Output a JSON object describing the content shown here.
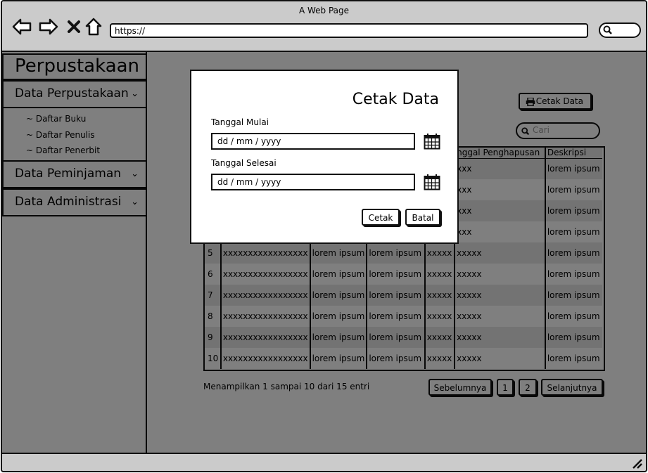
{
  "window": {
    "title": "A Web Page",
    "url": "https://"
  },
  "sidebar": {
    "title": "Perpustakaan",
    "groups": [
      {
        "label": "Data Perpustakaan",
        "items": [
          "~ Daftar Buku",
          "~ Daftar Penulis",
          "~ Daftar Penerbit"
        ]
      },
      {
        "label": "Data Peminjaman"
      },
      {
        "label": "Data Administrasi"
      }
    ]
  },
  "main": {
    "print_button": "Cetak Data",
    "search_placeholder": "Cari",
    "table": {
      "headers": [
        "nggal Penghapusan",
        "Deskripsi"
      ],
      "rows": [
        [
          "",
          "",
          "",
          "",
          "",
          "xxx",
          "lorem ipsum"
        ],
        [
          "",
          "",
          "",
          "",
          "",
          "xxx",
          "lorem ipsum"
        ],
        [
          "",
          "",
          "",
          "",
          "",
          "xxx",
          "lorem ipsum"
        ],
        [
          "",
          "",
          "",
          "",
          "",
          "xxx",
          "lorem ipsum"
        ],
        [
          "5",
          "xxxxxxxxxxxxxxxxx",
          "lorem ipsum",
          "lorem ipsum",
          "xxxxx",
          "xxxxx",
          "lorem ipsum"
        ],
        [
          "6",
          "xxxxxxxxxxxxxxxxx",
          "lorem ipsum",
          "lorem ipsum",
          "xxxxx",
          "xxxxx",
          "lorem ipsum"
        ],
        [
          "7",
          "xxxxxxxxxxxxxxxxx",
          "lorem ipsum",
          "lorem ipsum",
          "xxxxx",
          "xxxxx",
          "lorem ipsum"
        ],
        [
          "8",
          "xxxxxxxxxxxxxxxxx",
          "lorem ipsum",
          "lorem ipsum",
          "xxxxx",
          "xxxxx",
          "lorem ipsum"
        ],
        [
          "9",
          "xxxxxxxxxxxxxxxxx",
          "lorem ipsum",
          "lorem ipsum",
          "xxxxx",
          "xxxxx",
          "lorem ipsum"
        ],
        [
          "10",
          "xxxxxxxxxxxxxxxxx",
          "lorem ipsum",
          "lorem ipsum",
          "xxxxx",
          "xxxxx",
          "lorem ipsum"
        ]
      ]
    },
    "info": "Menampilkan 1 sampai 10 dari 15 entri",
    "pagination": {
      "prev": "Sebelumnya",
      "pages": [
        "1",
        "2"
      ],
      "next": "Selanjutnya"
    }
  },
  "modal": {
    "title": "Cetak Data",
    "start_label": "Tanggal Mulai",
    "start_value": "dd / mm / yyyy",
    "end_label": "Tanggal Selesai",
    "end_value": "dd / mm / yyyy",
    "print_button": "Cetak",
    "cancel_button": "Batal"
  }
}
